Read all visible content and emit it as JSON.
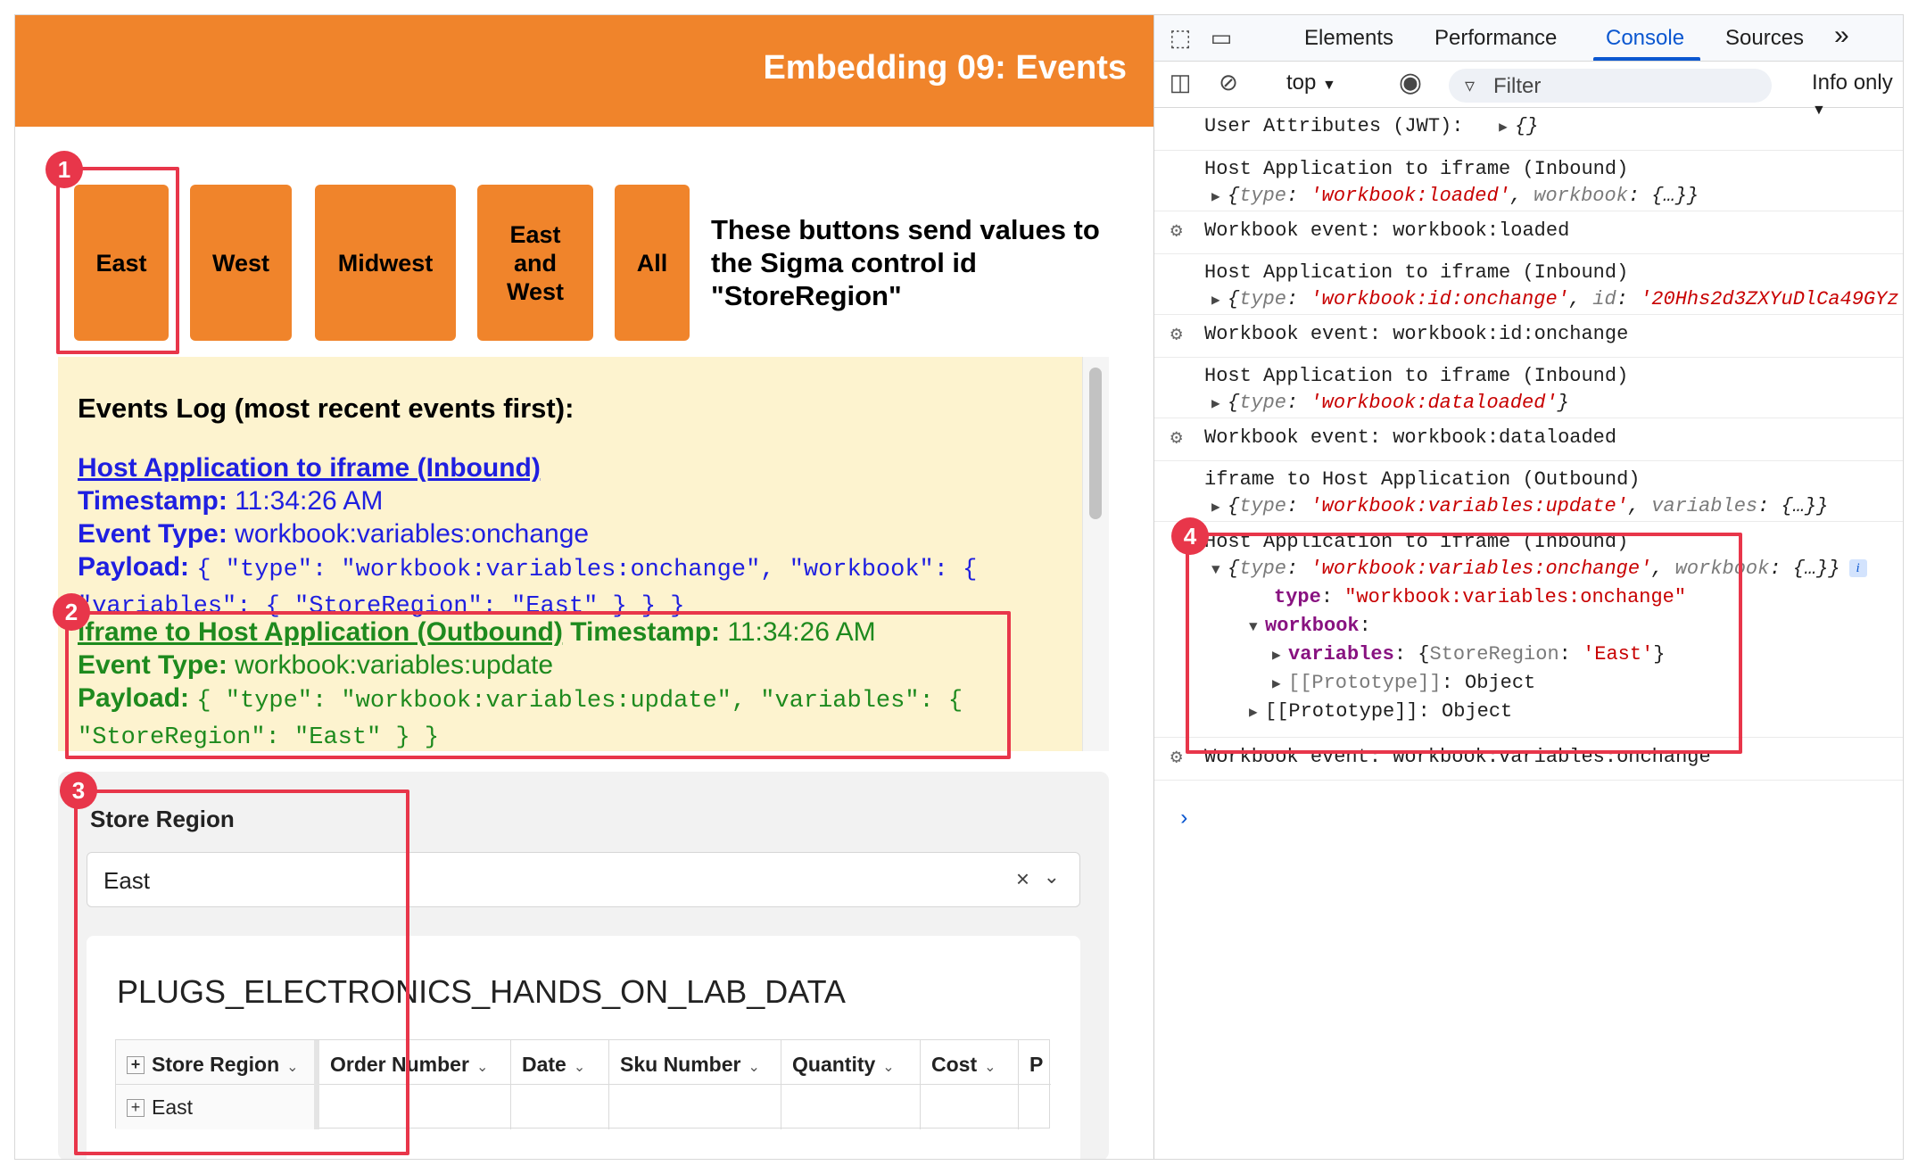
{
  "app": {
    "title": "Embedding 09: Events",
    "buttons": [
      {
        "label": "East"
      },
      {
        "label": "West"
      },
      {
        "label": "Midwest"
      },
      {
        "label": "East and West"
      },
      {
        "label": "All"
      }
    ],
    "buttons_note": "These buttons send values to the Sigma control id \"StoreRegion\"",
    "events_log": {
      "title": "Events Log (most recent events first):",
      "entries": [
        {
          "header": "Host Application to iframe (Inbound)",
          "timestamp_label": "Timestamp:",
          "timestamp": "11:34:26 AM",
          "event_type_label": "Event Type:",
          "event_type": "workbook:variables:onchange",
          "payload_label": "Payload:",
          "payload": "{ \"type\": \"workbook:variables:onchange\", \"workbook\": { \"variables\": { \"StoreRegion\": \"East\" } } }"
        },
        {
          "header": "iframe to Host Application (Outbound)",
          "timestamp_label": "Timestamp:",
          "timestamp": "11:34:26 AM",
          "event_type_label": "Event Type:",
          "event_type": "workbook:variables:update",
          "payload_label": "Payload:",
          "payload": "{ \"type\": \"workbook:variables:update\", \"variables\": { \"StoreRegion\": \"East\" } }"
        }
      ]
    },
    "sigma": {
      "control_label": "Store Region",
      "control_value": "East",
      "clear_glyph": "×",
      "table_title": "PLUGS_ELECTRONICS_HANDS_ON_LAB_DATA",
      "columns": [
        "Store Region",
        "Order Number",
        "Date",
        "Sku Number",
        "Quantity",
        "Cost",
        "P"
      ],
      "first_row": [
        "East",
        "",
        "",
        "",
        "",
        "",
        ""
      ]
    }
  },
  "devtools": {
    "tabs": [
      "Elements",
      "Performance",
      "Console",
      "Sources"
    ],
    "active_tab": "Console",
    "more_glyph": "»",
    "toolbar": {
      "context": "top",
      "filter_placeholder": "Filter",
      "levels": "Info only"
    },
    "console": {
      "jwt_label": "User Attributes (JWT):",
      "jwt_value": "{}",
      "inbound_label": "Host Application to iframe (Inbound)",
      "outbound_label": "iframe to Host Application (Outbound)",
      "type_key": "type",
      "workbook_key": "workbook",
      "id_key": "id",
      "variables_key": "variables",
      "obj_collapsed": "{…}",
      "loaded_type": "'workbook:loaded'",
      "idchange_type": "'workbook:id:onchange'",
      "idchange_id": "'20Hhs2d3ZXYuDlCa49GYz",
      "dataloaded_type": "'workbook:dataloaded'",
      "update_type": "'workbook:variables:update'",
      "onchange_type": "'workbook:variables:onchange'",
      "event_loaded": "Workbook event: workbook:loaded",
      "event_idchange": "Workbook event: workbook:id:onchange",
      "event_dataloaded": "Workbook event: workbook:dataloaded",
      "event_onchange": "Workbook event: workbook:variables:onchange",
      "expanded_type_value": "\"workbook:variables:onchange\"",
      "variables_preview_key": "StoreRegion",
      "variables_preview_value": "'East'",
      "prototype_label": "[[Prototype]]",
      "prototype_value": "Object",
      "info_badge": "i",
      "prompt": "›"
    }
  },
  "annotations": [
    "1",
    "2",
    "3",
    "4"
  ],
  "colors": {
    "app_orange": "#f0842b",
    "log_bg": "#fdf3cf",
    "inbound_blue": "#1f1fe0",
    "outbound_green": "#1e8a1e",
    "highlight_red": "#e8364a",
    "devtools_blue": "#0b57d0"
  }
}
